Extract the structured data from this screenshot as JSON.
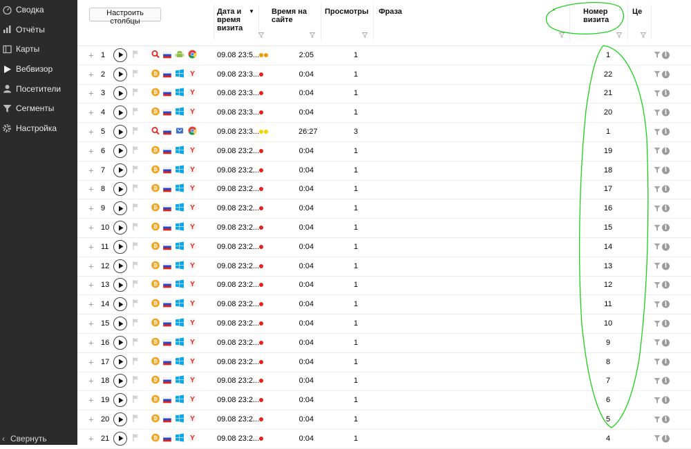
{
  "sidebar": {
    "items": [
      {
        "label": "Сводка",
        "icon": "gauge-icon"
      },
      {
        "label": "Отчёты",
        "icon": "bar-chart-icon"
      },
      {
        "label": "Карты",
        "icon": "map-icon"
      },
      {
        "label": "Вебвизор",
        "icon": "play-icon"
      },
      {
        "label": "Посетители",
        "icon": "user-icon"
      },
      {
        "label": "Сегменты",
        "icon": "funnel-icon"
      },
      {
        "label": "Настройка",
        "icon": "gear-icon"
      }
    ],
    "collapse_label": "Свернуть"
  },
  "toolbar": {
    "configure_label": "Настроить столбцы"
  },
  "columns": {
    "datetime": "Дата и время визита",
    "time_on_site": "Время на сайте",
    "pageviews": "Просмотры",
    "phrase": "Фраза",
    "visit_number": "Номер визита",
    "goals": "Це"
  },
  "colors": {
    "sidebar_bg": "#2b2b2b",
    "red_dot": "#e8211b",
    "orange_dot": "#f29b00",
    "yellow_dot": "#f3d400",
    "annotation_green": "#1ad11a"
  },
  "rows": [
    {
      "n": "1",
      "date": "09.08 23:5...",
      "dots": [
        "orange",
        "orange"
      ],
      "time": "2:05",
      "views": "1",
      "visit": "1",
      "source": "search-icon",
      "os": "android-icon",
      "browser": "chrome-icon"
    },
    {
      "n": "2",
      "date": "09.08 23:3...",
      "dots": [
        "red"
      ],
      "time": "0:04",
      "views": "1",
      "visit": "22",
      "source": "bitcoin-icon",
      "os": "windows-icon",
      "browser": "yandex-browser-icon"
    },
    {
      "n": "3",
      "date": "09.08 23:3...",
      "dots": [
        "red"
      ],
      "time": "0:04",
      "views": "1",
      "visit": "21",
      "source": "bitcoin-icon",
      "os": "windows-icon",
      "browser": "yandex-browser-icon"
    },
    {
      "n": "4",
      "date": "09.08 23:3...",
      "dots": [
        "red"
      ],
      "time": "0:04",
      "views": "1",
      "visit": "20",
      "source": "bitcoin-icon",
      "os": "windows-icon",
      "browser": "yandex-browser-icon"
    },
    {
      "n": "5",
      "date": "09.08 23:3...",
      "dots": [
        "yellow",
        "yellow"
      ],
      "time": "26:27",
      "views": "3",
      "visit": "1",
      "source": "search-icon",
      "os": "device-icon",
      "browser": "chrome-icon"
    },
    {
      "n": "6",
      "date": "09.08 23:2...",
      "dots": [
        "red"
      ],
      "time": "0:04",
      "views": "1",
      "visit": "19",
      "source": "bitcoin-icon",
      "os": "windows-icon",
      "browser": "yandex-browser-icon"
    },
    {
      "n": "7",
      "date": "09.08 23:2...",
      "dots": [
        "red"
      ],
      "time": "0:04",
      "views": "1",
      "visit": "18",
      "source": "bitcoin-icon",
      "os": "windows-icon",
      "browser": "yandex-browser-icon"
    },
    {
      "n": "8",
      "date": "09.08 23:2...",
      "dots": [
        "red"
      ],
      "time": "0:04",
      "views": "1",
      "visit": "17",
      "source": "bitcoin-icon",
      "os": "windows-icon",
      "browser": "yandex-browser-icon"
    },
    {
      "n": "9",
      "date": "09.08 23:2...",
      "dots": [
        "red"
      ],
      "time": "0:04",
      "views": "1",
      "visit": "16",
      "source": "bitcoin-icon",
      "os": "windows-icon",
      "browser": "yandex-browser-icon"
    },
    {
      "n": "10",
      "date": "09.08 23:2...",
      "dots": [
        "red"
      ],
      "time": "0:04",
      "views": "1",
      "visit": "15",
      "source": "bitcoin-icon",
      "os": "windows-icon",
      "browser": "yandex-browser-icon"
    },
    {
      "n": "11",
      "date": "09.08 23:2...",
      "dots": [
        "red"
      ],
      "time": "0:04",
      "views": "1",
      "visit": "14",
      "source": "bitcoin-icon",
      "os": "windows-icon",
      "browser": "yandex-browser-icon"
    },
    {
      "n": "12",
      "date": "09.08 23:2...",
      "dots": [
        "red"
      ],
      "time": "0:04",
      "views": "1",
      "visit": "13",
      "source": "bitcoin-icon",
      "os": "windows-icon",
      "browser": "yandex-browser-icon"
    },
    {
      "n": "13",
      "date": "09.08 23:2...",
      "dots": [
        "red"
      ],
      "time": "0:04",
      "views": "1",
      "visit": "12",
      "source": "bitcoin-icon",
      "os": "windows-icon",
      "browser": "yandex-browser-icon"
    },
    {
      "n": "14",
      "date": "09.08 23:2...",
      "dots": [
        "red"
      ],
      "time": "0:04",
      "views": "1",
      "visit": "11",
      "source": "bitcoin-icon",
      "os": "windows-icon",
      "browser": "yandex-browser-icon"
    },
    {
      "n": "15",
      "date": "09.08 23:2...",
      "dots": [
        "red"
      ],
      "time": "0:04",
      "views": "1",
      "visit": "10",
      "source": "bitcoin-icon",
      "os": "windows-icon",
      "browser": "yandex-browser-icon"
    },
    {
      "n": "16",
      "date": "09.08 23:2...",
      "dots": [
        "red"
      ],
      "time": "0:04",
      "views": "1",
      "visit": "9",
      "source": "bitcoin-icon",
      "os": "windows-icon",
      "browser": "yandex-browser-icon"
    },
    {
      "n": "17",
      "date": "09.08 23:2...",
      "dots": [
        "red"
      ],
      "time": "0:04",
      "views": "1",
      "visit": "8",
      "source": "bitcoin-icon",
      "os": "windows-icon",
      "browser": "yandex-browser-icon"
    },
    {
      "n": "18",
      "date": "09.08 23:2...",
      "dots": [
        "red"
      ],
      "time": "0:04",
      "views": "1",
      "visit": "7",
      "source": "bitcoin-icon",
      "os": "windows-icon",
      "browser": "yandex-browser-icon"
    },
    {
      "n": "19",
      "date": "09.08 23:2...",
      "dots": [
        "red"
      ],
      "time": "0:04",
      "views": "1",
      "visit": "6",
      "source": "bitcoin-icon",
      "os": "windows-icon",
      "browser": "yandex-browser-icon"
    },
    {
      "n": "20",
      "date": "09.08 23:2...",
      "dots": [
        "red"
      ],
      "time": "0:04",
      "views": "1",
      "visit": "5",
      "source": "bitcoin-icon",
      "os": "windows-icon",
      "browser": "yandex-browser-icon"
    },
    {
      "n": "21",
      "date": "09.08 23:2...",
      "dots": [
        "red"
      ],
      "time": "0:04",
      "views": "1",
      "visit": "4",
      "source": "bitcoin-icon",
      "os": "windows-icon",
      "browser": "yandex-browser-icon"
    }
  ]
}
